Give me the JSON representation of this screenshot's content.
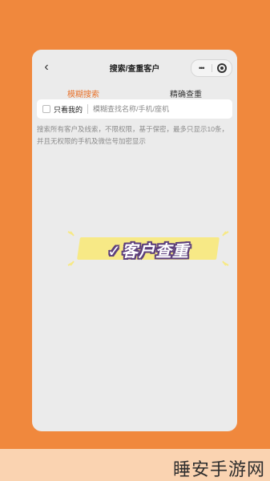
{
  "header": {
    "title": "搜索/查重客户",
    "back_icon": "back-chevron-icon",
    "more_icon": "more-dots-icon",
    "close_icon": "target-close-icon"
  },
  "tabs": [
    {
      "label": "模糊搜索",
      "active": true
    },
    {
      "label": "精确查重",
      "active": false
    }
  ],
  "search": {
    "only_mine_label": "只看我的",
    "only_mine_checked": false,
    "placeholder": "模糊查找名称/手机/座机",
    "value": ""
  },
  "hint_text": "搜索所有客户及线索，不限权限，基于保密，最多只显示10条，并且无权限的手机及微信号加密显示",
  "banner": {
    "text": "✓客户查重"
  },
  "watermark": "睡安手游网",
  "colors": {
    "accent": "#e8722b",
    "background": "#f0883d",
    "banner_fill": "#f7e986",
    "banner_outline": "#5d3f7c"
  }
}
